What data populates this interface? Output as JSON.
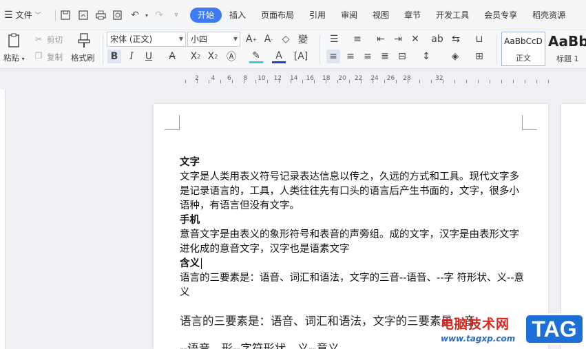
{
  "menu": {
    "file_label": "文件",
    "tabs": [
      "开始",
      "插入",
      "页面布局",
      "引用",
      "审阅",
      "视图",
      "章节",
      "开发工具",
      "会员专享",
      "稻壳资源"
    ]
  },
  "ribbon": {
    "paste_label": "粘贴",
    "cut_label": "剪切",
    "copy_label": "复制",
    "format_painter_label": "格式刷",
    "font_name": "宋体 (正文)",
    "font_size": "小四",
    "styles": [
      {
        "sample": "AaBbCcD",
        "name": "正文"
      },
      {
        "sample": "AaBb",
        "name": "标题 1"
      }
    ]
  },
  "ruler": {
    "numbers": [
      "2",
      "4",
      "6",
      "8",
      "10",
      "12",
      "14",
      "16",
      "18",
      "20",
      "22",
      "24",
      "26",
      "28",
      "32"
    ]
  },
  "document": {
    "heading1": "文字",
    "para1": "文字是人类用表义符号记录表达信息以传之，久远的方式和工具。现代文字多是记录语言的，工具，人类往往先有口头的语言后产生书面的，文字，很多小语种，有语言但没有文字。",
    "heading2": "手机",
    "para2": "意音文字是由表义的象形符号和表音的声旁组。成的文字，汉字是由表形文字进化成的意音文字，汉字也是语素文字",
    "heading3": "含义",
    "para3": "语言的三要素是：语音、词汇和语法，文字的三音--语音、--字 符形状、义--意义",
    "para4": "语言的三要素是：语音、词汇和语法，文字的三要素是：音",
    "para5": "--语音、形--字符形状、义--意义。"
  },
  "watermark": {
    "site_name": "电脑技术网",
    "url": "www.tagxp.com",
    "logo": "TAG"
  }
}
